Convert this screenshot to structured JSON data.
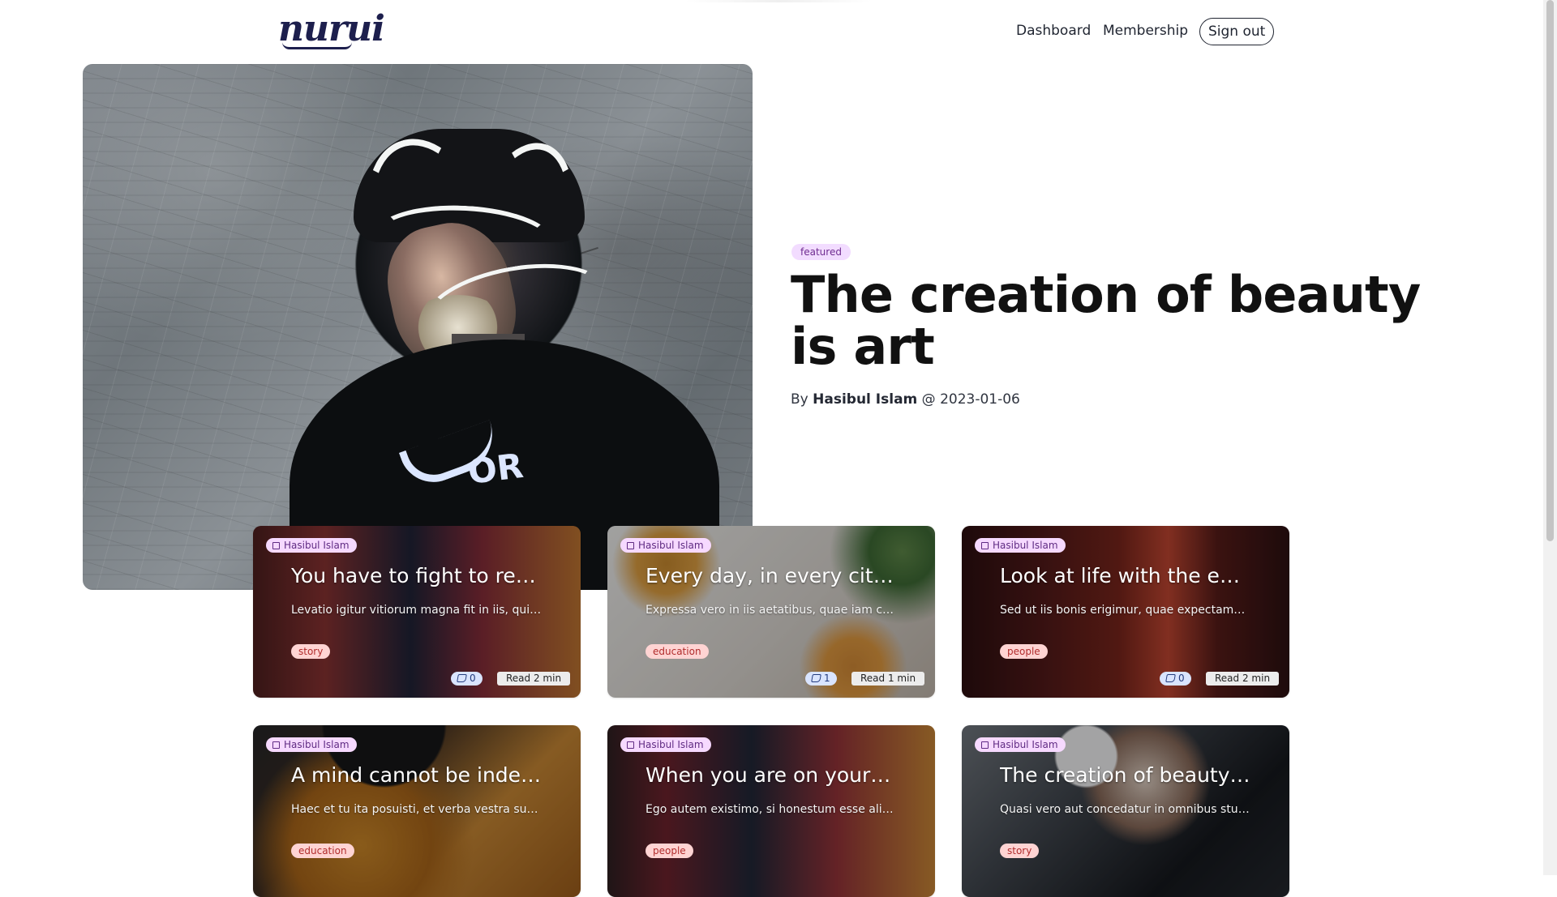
{
  "header": {
    "logo_text": "nurui",
    "nav": [
      "Dashboard",
      "Membership"
    ],
    "sign_out_label": "Sign out"
  },
  "hero": {
    "badge": "featured",
    "title": "The creation of beauty is art",
    "meta_by": "By",
    "author": "Hasibul Islam",
    "meta_at": "@ 2023-01-06"
  },
  "cards": [
    {
      "author": "Hasibul Islam",
      "title": "You have to fight to reac...",
      "excerpt": "Levatio igitur vitiorum magna fit in iis, qui ha...",
      "tag": "story",
      "likes": "0",
      "read": "Read 2 min"
    },
    {
      "author": "Hasibul Islam",
      "title": "Every day, in every city a...",
      "excerpt": "Expressa vero in iis aetatibus, quae iam confi...",
      "tag": "education",
      "likes": "1",
      "read": "Read 1 min"
    },
    {
      "author": "Hasibul Islam",
      "title": "Look at life with the eyes...",
      "excerpt": "Sed ut iis bonis erigimur, quae expectamus, s...",
      "tag": "people",
      "likes": "0",
      "read": "Read 2 min"
    },
    {
      "author": "Hasibul Islam",
      "title": "A mind cannot be indepe...",
      "excerpt": "Haec et tu ita posuisti, et verba vestra sunt. C...",
      "tag": "education"
    },
    {
      "author": "Hasibul Islam",
      "title": "When you are on your w...",
      "excerpt": "Ego autem existimo, si honestum esse aliqui...",
      "tag": "people"
    },
    {
      "author": "Hasibul Islam",
      "title": "The creation of beauty is ...",
      "excerpt": "Quasi vero aut concedatur in omnibus stultis ...",
      "tag": "story"
    }
  ],
  "colors": {
    "featured_badge": "#f2dcff",
    "tag_badge": "#ffd4d3",
    "likes_badge": "#d9e4ff"
  }
}
